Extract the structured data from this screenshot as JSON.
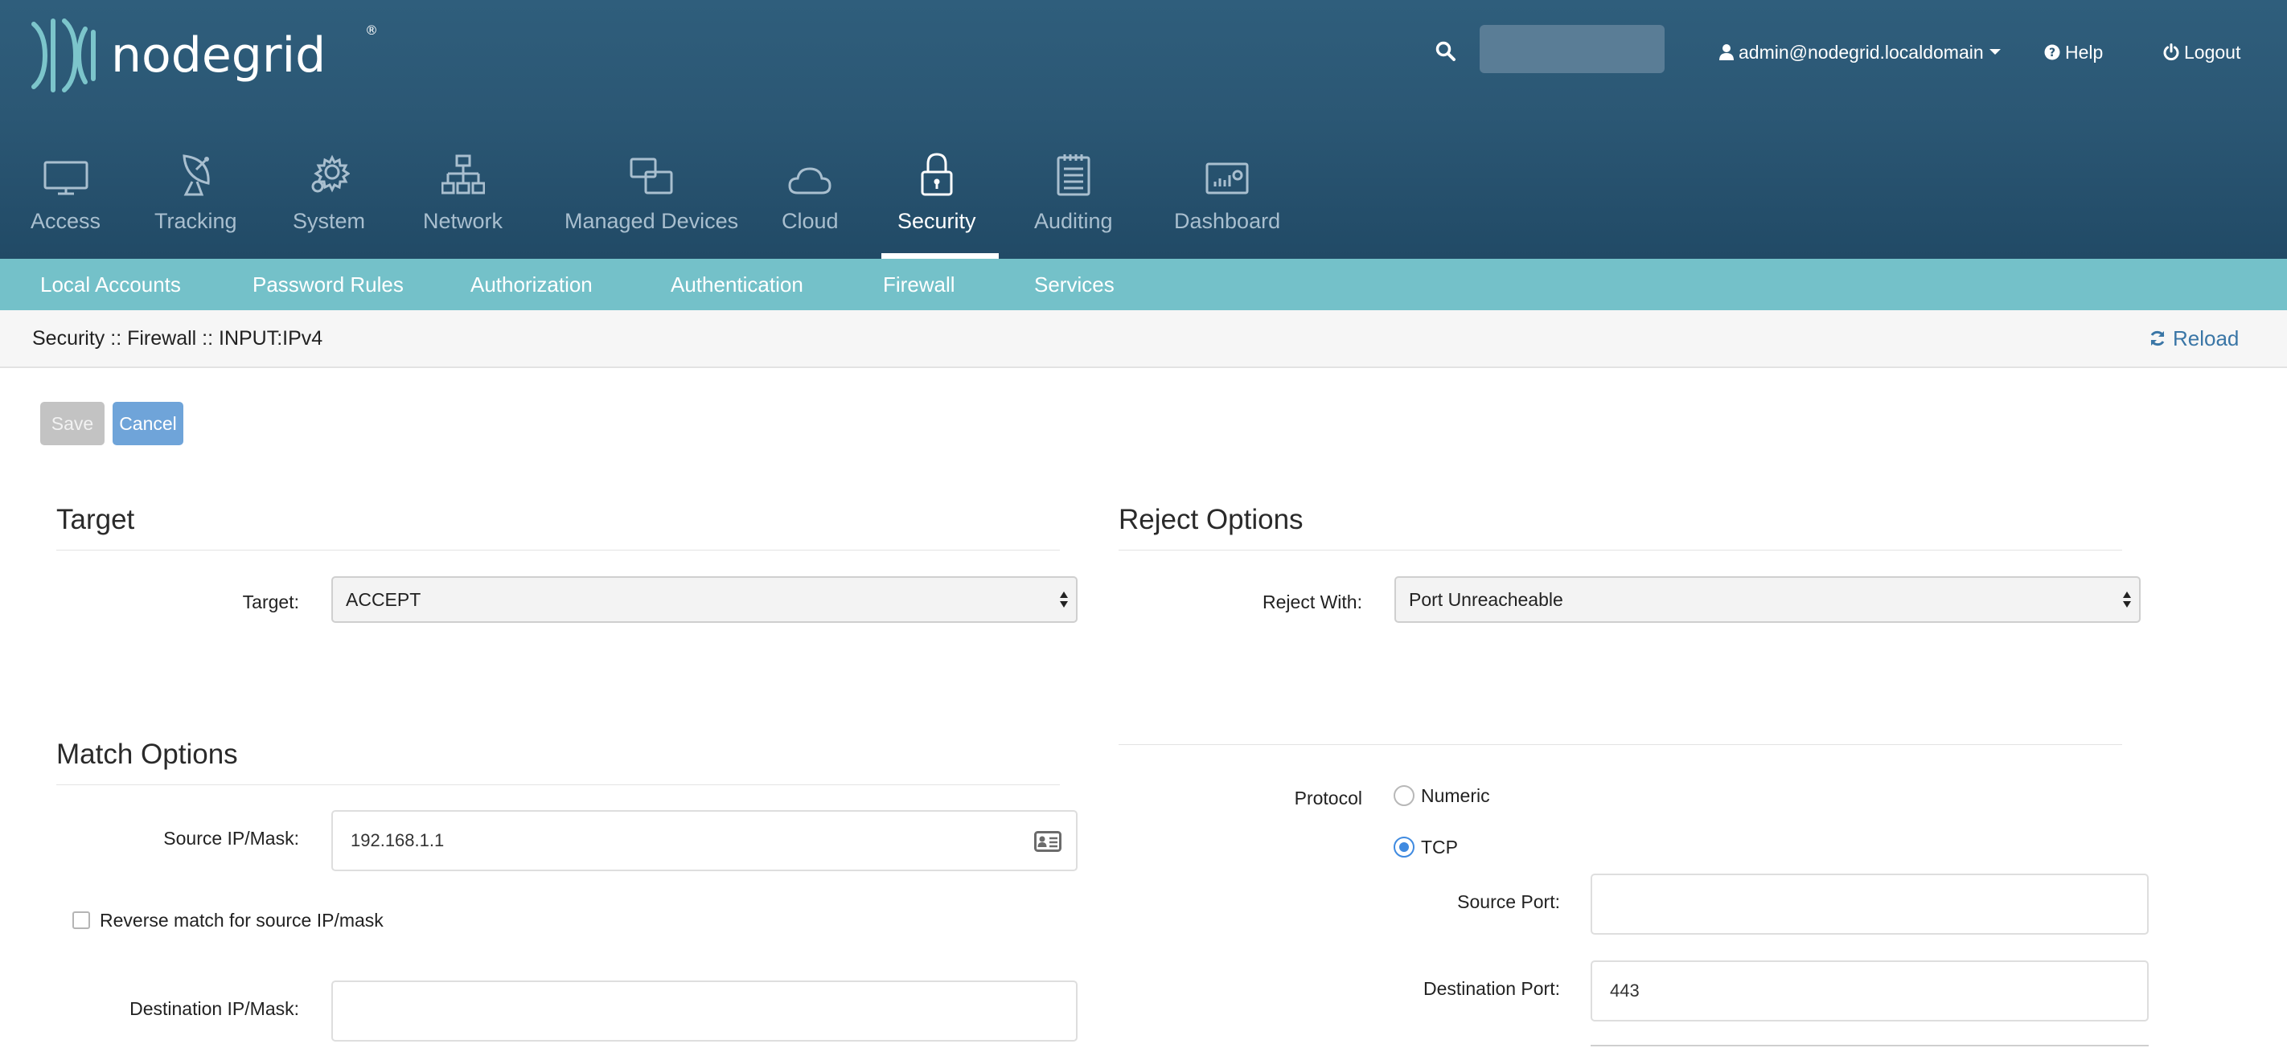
{
  "header": {
    "logo_text": "nodegrid",
    "logo_reg": "®",
    "search_placeholder": "",
    "user": "admin@nodegrid.localdomain",
    "help": "Help",
    "logout": "Logout"
  },
  "main_nav": [
    {
      "label": "Access",
      "icon": "monitor-icon"
    },
    {
      "label": "Tracking",
      "icon": "satellite-dish-icon"
    },
    {
      "label": "System",
      "icon": "gear-icon"
    },
    {
      "label": "Network",
      "icon": "network-tree-icon"
    },
    {
      "label": "Managed Devices",
      "icon": "devices-icon"
    },
    {
      "label": "Cloud",
      "icon": "cloud-icon"
    },
    {
      "label": "Security",
      "icon": "lock-icon",
      "active": true
    },
    {
      "label": "Auditing",
      "icon": "notepad-icon"
    },
    {
      "label": "Dashboard",
      "icon": "chart-icon"
    }
  ],
  "sub_nav": [
    {
      "label": "Local Accounts"
    },
    {
      "label": "Password Rules"
    },
    {
      "label": "Authorization"
    },
    {
      "label": "Authentication"
    },
    {
      "label": "Firewall",
      "active": true
    },
    {
      "label": "Services"
    }
  ],
  "breadcrumb": "Security :: Firewall :: INPUT:IPv4",
  "reload": "Reload",
  "buttons": {
    "save": "Save",
    "cancel": "Cancel"
  },
  "target_section": {
    "title": "Target",
    "target_label": "Target:",
    "target_value": "ACCEPT"
  },
  "reject_section": {
    "title": "Reject Options",
    "reject_label": "Reject With:",
    "reject_value": "Port Unreacheable"
  },
  "match_section": {
    "title": "Match Options",
    "source_label": "Source IP/Mask:",
    "source_value": "192.168.1.1",
    "reverse_source_label": "Reverse match for source IP/mask",
    "reverse_source_checked": false,
    "dest_label": "Destination IP/Mask:",
    "dest_value": ""
  },
  "protocol_section": {
    "protocol_label": "Protocol",
    "options": [
      {
        "label": "Numeric",
        "checked": false
      },
      {
        "label": "TCP",
        "checked": true
      }
    ],
    "source_port_label": "Source Port:",
    "source_port_value": "",
    "dest_port_label": "Destination Port:",
    "dest_port_value": "443"
  },
  "colors": {
    "header_bg": "#2b5774",
    "subnav_bg": "#74c1c9",
    "accent_blue": "#3f8ae0",
    "cancel_bg": "#6fa4d9",
    "link_blue": "#3a76a6"
  }
}
